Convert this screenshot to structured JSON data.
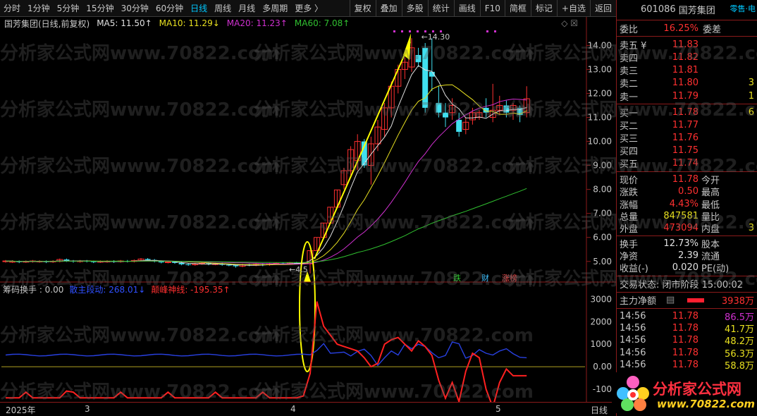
{
  "toolbar": {
    "periods": [
      "分时",
      "1分钟",
      "5分钟",
      "15分钟",
      "30分钟",
      "60分钟",
      "日线",
      "周线",
      "月线",
      "多周期",
      "更多 〉"
    ],
    "active": "日线",
    "actions": [
      "复权",
      "叠加",
      "多股",
      "统计",
      "画线",
      "F10",
      "简框",
      "标记",
      "+自选",
      "返回"
    ]
  },
  "chart_title": {
    "name": "国芳集团(日线,前复权)",
    "ma5": "MA5: 11.50↑",
    "ma10": "MA10: 11.29↓",
    "ma20": "MA20: 11.23↑",
    "ma60": "MA60: 7.08↑"
  },
  "indicator_title": {
    "name": "筹码换手 : 0.00",
    "s1": "散主段动: 268.01↓",
    "s2": "颠峰神线: -195.35↑"
  },
  "annotations": {
    "high": "14.30",
    "low": "4.5",
    "marks": [
      "跌",
      "财",
      "涨榜"
    ]
  },
  "x_axis": {
    "labels": [
      "2025年",
      "3",
      "4",
      "5"
    ],
    "period": "日线"
  },
  "chart_data": {
    "type": "candlestick",
    "price_axis": [
      "14.00",
      "13.00",
      "12.00",
      "11.00",
      "10.00",
      "9.00",
      "8.00",
      "7.00",
      "6.00",
      "5.00"
    ],
    "price_range": [
      4.2,
      14.6
    ],
    "indicator_axis": [
      "3000",
      "2000",
      "1000",
      "0.00",
      "-100"
    ],
    "indicator_range": [
      -1500,
      3200
    ],
    "candles": [
      [
        5.0,
        5.02,
        4.95,
        5.06
      ],
      [
        5.0,
        5.0,
        4.94,
        5.05
      ],
      [
        5.0,
        4.98,
        4.93,
        5.04
      ],
      [
        4.98,
        5.0,
        4.94,
        5.04
      ],
      [
        5.0,
        5.02,
        4.95,
        5.06
      ],
      [
        5.0,
        5.01,
        4.95,
        5.05
      ],
      [
        5.0,
        4.99,
        4.93,
        5.04
      ],
      [
        4.99,
        5.01,
        4.94,
        5.05
      ],
      [
        5.0,
        5.08,
        4.96,
        5.12
      ],
      [
        5.08,
        5.02,
        4.98,
        5.12
      ],
      [
        5.02,
        5.0,
        4.95,
        5.06
      ],
      [
        5.0,
        5.02,
        4.95,
        5.06
      ],
      [
        5.02,
        5.0,
        4.96,
        5.06
      ],
      [
        5.0,
        4.98,
        4.93,
        5.03
      ],
      [
        4.98,
        5.0,
        4.94,
        5.04
      ],
      [
        5.0,
        5.01,
        4.95,
        5.05
      ],
      [
        5.01,
        4.99,
        4.94,
        5.05
      ],
      [
        4.99,
        5.02,
        4.95,
        5.06
      ],
      [
        5.02,
        5.0,
        4.96,
        5.06
      ],
      [
        5.0,
        5.04,
        4.96,
        5.08
      ],
      [
        5.04,
        5.1,
        5.0,
        5.14
      ],
      [
        5.1,
        5.06,
        5.02,
        5.14
      ],
      [
        5.06,
        5.0,
        4.96,
        5.1
      ],
      [
        5.0,
        4.96,
        4.92,
        5.04
      ],
      [
        4.96,
        4.98,
        4.92,
        5.02
      ],
      [
        4.98,
        4.94,
        4.9,
        5.02
      ],
      [
        4.94,
        4.88,
        4.84,
        4.98
      ],
      [
        4.88,
        4.86,
        4.82,
        4.92
      ],
      [
        4.86,
        4.9,
        4.82,
        4.94
      ],
      [
        4.9,
        4.92,
        4.86,
        4.96
      ],
      [
        4.92,
        4.88,
        4.84,
        4.96
      ],
      [
        4.88,
        4.9,
        4.84,
        4.94
      ],
      [
        4.9,
        4.86,
        4.82,
        4.94
      ],
      [
        4.86,
        4.84,
        4.8,
        4.9
      ],
      [
        4.84,
        4.8,
        4.74,
        4.88
      ],
      [
        4.8,
        4.86,
        4.76,
        4.9
      ],
      [
        4.86,
        4.84,
        4.8,
        4.9
      ],
      [
        4.84,
        4.88,
        4.8,
        4.92
      ],
      [
        4.88,
        4.86,
        4.8,
        4.92
      ],
      [
        4.86,
        4.9,
        4.82,
        4.94
      ],
      [
        4.9,
        4.92,
        4.86,
        4.96
      ],
      [
        4.92,
        4.9,
        4.86,
        4.96
      ],
      [
        4.9,
        4.94,
        4.86,
        4.98
      ],
      [
        4.94,
        4.92,
        4.88,
        4.98
      ],
      [
        4.92,
        4.95,
        4.88,
        4.98
      ],
      [
        4.9,
        5.45,
        4.5,
        5.45
      ],
      [
        5.45,
        6.0,
        5.45,
        6.0
      ],
      [
        6.0,
        6.6,
        6.0,
        6.6
      ],
      [
        6.6,
        7.26,
        6.6,
        7.26
      ],
      [
        7.26,
        7.98,
        7.26,
        7.98
      ],
      [
        8.2,
        8.78,
        8.0,
        8.9
      ],
      [
        8.78,
        9.66,
        8.6,
        9.8
      ],
      [
        9.2,
        10.0,
        8.8,
        10.3
      ],
      [
        10.0,
        9.0,
        8.9,
        10.1
      ],
      [
        9.0,
        9.9,
        8.2,
        10.2
      ],
      [
        9.9,
        10.6,
        9.6,
        10.9
      ],
      [
        10.5,
        11.4,
        10.2,
        11.6
      ],
      [
        11.4,
        12.3,
        11.0,
        12.5
      ],
      [
        12.3,
        13.0,
        12.0,
        13.2
      ],
      [
        13.0,
        13.3,
        12.6,
        13.5
      ],
      [
        13.1,
        13.9,
        12.9,
        14.3
      ],
      [
        13.6,
        13.3,
        13.1,
        13.9
      ],
      [
        13.9,
        11.4,
        11.2,
        14.1
      ],
      [
        12.9,
        12.7,
        12.1,
        14.3
      ],
      [
        11.6,
        11.2,
        11.0,
        12.3
      ],
      [
        11.2,
        11.0,
        10.6,
        11.6
      ],
      [
        11.2,
        11.5,
        10.9,
        11.8
      ],
      [
        10.9,
        10.4,
        10.2,
        11.2
      ],
      [
        10.5,
        10.8,
        10.3,
        11.0
      ],
      [
        10.9,
        11.2,
        10.7,
        11.4
      ],
      [
        11.0,
        11.2,
        10.9,
        11.3
      ],
      [
        11.4,
        11.2,
        11.0,
        11.8
      ],
      [
        11.0,
        11.3,
        10.8,
        12.4
      ],
      [
        11.3,
        11.5,
        11.1,
        11.9
      ],
      [
        11.5,
        11.2,
        11.0,
        11.7
      ],
      [
        11.3,
        11.5,
        10.9,
        11.6
      ],
      [
        11.4,
        11.1,
        10.8,
        11.5
      ],
      [
        11.2,
        11.78,
        11.0,
        12.3
      ]
    ],
    "series_colors": {
      "ma5": "#e0e0e0",
      "ma10": "#e8e020",
      "ma20": "#d030d0",
      "ma60": "#30c030"
    }
  },
  "panel": {
    "code": "601086",
    "name": "国芳集团",
    "tag": "零售·电",
    "webi_label": "委比",
    "webi_value": "16.25%",
    "wecha_label": "委差",
    "sells": [
      {
        "label": "卖五 ¥",
        "price": "11.83",
        "vol": ""
      },
      {
        "label": "卖四",
        "price": "11.82",
        "vol": ""
      },
      {
        "label": "卖三",
        "price": "11.81",
        "vol": ""
      },
      {
        "label": "卖二",
        "price": "11.80",
        "vol": "3"
      },
      {
        "label": "卖一",
        "price": "11.79",
        "vol": "1"
      }
    ],
    "buys": [
      {
        "label": "买一",
        "price": "11.78",
        "vol": "6"
      },
      {
        "label": "买二",
        "price": "11.77",
        "vol": ""
      },
      {
        "label": "买三",
        "price": "11.76",
        "vol": ""
      },
      {
        "label": "买四",
        "price": "11.75",
        "vol": ""
      },
      {
        "label": "买五",
        "price": "11.74",
        "vol": ""
      }
    ],
    "quote": [
      {
        "l1": "现价",
        "v1": "11.78",
        "c1": "red",
        "l2": "今开",
        "v2": ""
      },
      {
        "l1": "涨跌",
        "v1": "0.50",
        "c1": "red",
        "l2": "最高",
        "v2": ""
      },
      {
        "l1": "涨幅",
        "v1": "4.43%",
        "c1": "red",
        "l2": "最低",
        "v2": ""
      },
      {
        "l1": "总量",
        "v1": "847581",
        "c1": "yellow",
        "l2": "量比",
        "v2": ""
      },
      {
        "l1": "外盘",
        "v1": "473094",
        "c1": "red",
        "l2": "内盘",
        "v2": "3"
      }
    ],
    "info": [
      {
        "l1": "换手",
        "v1": "12.73%",
        "l2": "股本"
      },
      {
        "l1": "净资",
        "v1": "2.39",
        "l2": "流通"
      },
      {
        "l1": "收益(-)",
        "v1": "0.020",
        "l2": "PE(动)"
      }
    ],
    "status": "交易状态: 闭市阶段 15:00:02",
    "main_flow_label": "主力净额",
    "main_flow_value": "3938万",
    "ticks": [
      {
        "t": "14:56",
        "p": "11.78",
        "v": "86.5万",
        "vc": "#d030d0"
      },
      {
        "t": "14:56",
        "p": "11.78",
        "v": "41.7万",
        "vc": "#e8e020"
      },
      {
        "t": "14:56",
        "p": "11.78",
        "v": "48.2万",
        "vc": "#e8e020"
      },
      {
        "t": "14:56",
        "p": "11.78",
        "v": "56.3万",
        "vc": "#e8e020"
      },
      {
        "t": "14:56",
        "p": "11.78",
        "v": "58.8万",
        "vc": "#e8e020"
      }
    ]
  },
  "logo": {
    "title": "分析家公式网",
    "url": "www.70822.com"
  },
  "watermark": "分析家公式网www.70822.com"
}
